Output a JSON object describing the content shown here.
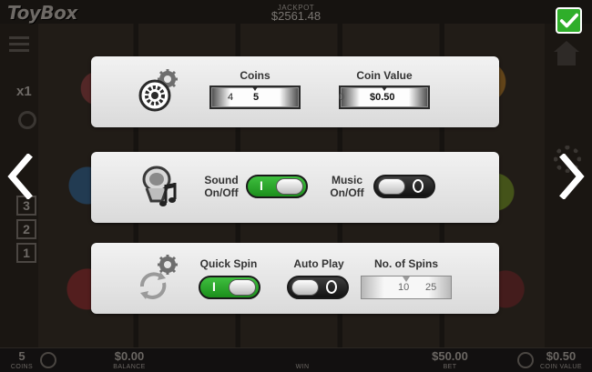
{
  "header": {
    "logo": "ToyBox",
    "jackpot_label": "JACKPOT",
    "jackpot_value": "$2561.48"
  },
  "left_ui": {
    "multiplier": "x1",
    "lines": [
      "3",
      "2",
      "1"
    ]
  },
  "coins_panel": {
    "coins_label": "Coins",
    "coins_values": [
      "4",
      "5"
    ],
    "coins_selected": "5",
    "coin_value_label": "Coin Value",
    "coin_value_selected": "$0.50"
  },
  "audio_panel": {
    "sound_label_1": "Sound",
    "sound_label_2": "On/Off",
    "sound_on": true,
    "sound_mark": "I",
    "music_label_1": "Music",
    "music_label_2": "On/Off",
    "music_on": false
  },
  "spin_panel": {
    "quick_spin_label": "Quick Spin",
    "quick_spin_on": true,
    "quick_spin_mark": "I",
    "auto_play_label": "Auto Play",
    "auto_play_on": false,
    "spins_label": "No. of Spins",
    "spins_values": [
      "10",
      "25"
    ]
  },
  "bottom_bar": {
    "coins_value": "5",
    "coins_label": "COINS",
    "balance_value": "$0.00",
    "balance_label": "BALANCE",
    "win_label": "WIN",
    "bet_value": "$50.00",
    "bet_label": "BET",
    "coin_value_value": "$0.50",
    "coin_value_label": "COIN VALUE"
  },
  "colors": {
    "toggle_on": "#2ea82e",
    "toggle_off": "#1e1e1e",
    "panel": "#e8e8e8",
    "confirm": "#2fae2a"
  },
  "icons": {
    "confirm": "checkmark-icon",
    "prev": "chevron-left-icon",
    "next": "chevron-right-icon",
    "coins_panel": "coin-gear-icon",
    "audio_panel": "speaker-music-icon",
    "spin_panel": "spin-gear-icon"
  }
}
